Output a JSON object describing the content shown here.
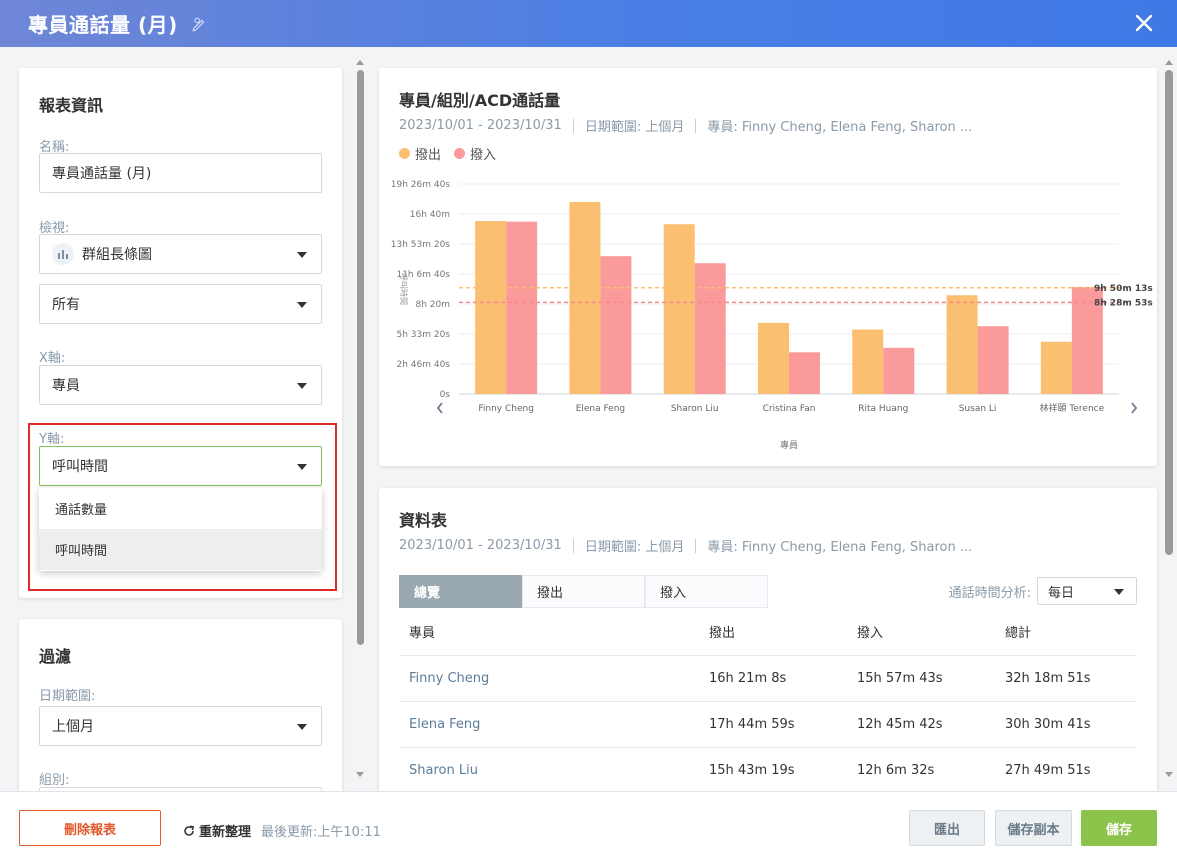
{
  "header": {
    "title": "專員通話量 (月)"
  },
  "info": {
    "heading": "報表資訊",
    "name_label": "名稱:",
    "name_value": "專員通話量 (月)",
    "view_label": "檢視:",
    "view_value": "群組長條圖",
    "scope_value": "所有",
    "x_label": "X軸:",
    "x_value": "專員",
    "y_label": "Y軸:",
    "y_value": "呼叫時間",
    "y_options": [
      "通話數量",
      "呼叫時間"
    ]
  },
  "filter": {
    "heading": "過濾",
    "date_label": "日期範圍:",
    "date_value": "上個月",
    "group_label": "組別:"
  },
  "chart_card": {
    "title": "專員/組別/ACD通話量",
    "range": "2023/10/01 - 2023/10/31",
    "date_range": "日期範圍: 上個月",
    "agents": "專員: Finny Cheng, Elena Feng, Sharon ..."
  },
  "chart_data": {
    "type": "bar",
    "categories": [
      "Finny Cheng",
      "Elena Feng",
      "Sharon Liu",
      "Cristina Fan",
      "Rita Huang",
      "Susan Li",
      "林祥頤 Terence"
    ],
    "series": [
      {
        "name": "撥出",
        "color": "#fbbf72",
        "values": [
          57668,
          64019,
          56599,
          23700,
          21500,
          32900,
          17400
        ]
      },
      {
        "name": "撥入",
        "color": "#fb9a9a",
        "values": [
          57463,
          45942,
          43592,
          13900,
          15400,
          22600,
          35700
        ]
      }
    ],
    "ylim": [
      0,
      70000
    ],
    "y_ticks": [
      "0s",
      "2h 46m 40s",
      "5h 33m 20s",
      "8h 20m",
      "11h 6m 40s",
      "13h 53m 20s",
      "16h 40m",
      "19h 26m 40s"
    ],
    "y_tick_values": [
      0,
      10000,
      20000,
      30000,
      40000,
      50000,
      60000,
      70000
    ],
    "ylabel": "呼叫時間",
    "xlabel": "專員",
    "reference_lines": [
      {
        "label": "9h 50m 13s",
        "value": 35413,
        "color": "#fbbf72"
      },
      {
        "label": "8h 28m 53s",
        "value": 30533,
        "color": "#f28a8a"
      }
    ],
    "grid": true,
    "legend": "top-left"
  },
  "table_card": {
    "title": "資料表",
    "range": "2023/10/01 - 2023/10/31",
    "date_range": "日期範圍: 上個月",
    "agents": "專員: Finny Cheng, Elena Feng, Sharon ...",
    "tabs": [
      "總覽",
      "撥出",
      "撥入"
    ],
    "analysis_label": "通話時間分析:",
    "analysis_value": "每日",
    "columns": [
      "專員",
      "撥出",
      "撥入",
      "總計"
    ],
    "rows": [
      [
        "Finny Cheng",
        "16h 21m 8s",
        "15h 57m 43s",
        "32h 18m 51s"
      ],
      [
        "Elena Feng",
        "17h 44m 59s",
        "12h 45m 42s",
        "30h 30m 41s"
      ],
      [
        "Sharon Liu",
        "15h 43m 19s",
        "12h 6m 32s",
        "27h 49m 51s"
      ]
    ]
  },
  "footer": {
    "delete": "刪除報表",
    "refresh": "重新整理",
    "updated": "最後更新:上午10:11",
    "export": "匯出",
    "save_copy": "儲存副本",
    "save": "儲存"
  }
}
